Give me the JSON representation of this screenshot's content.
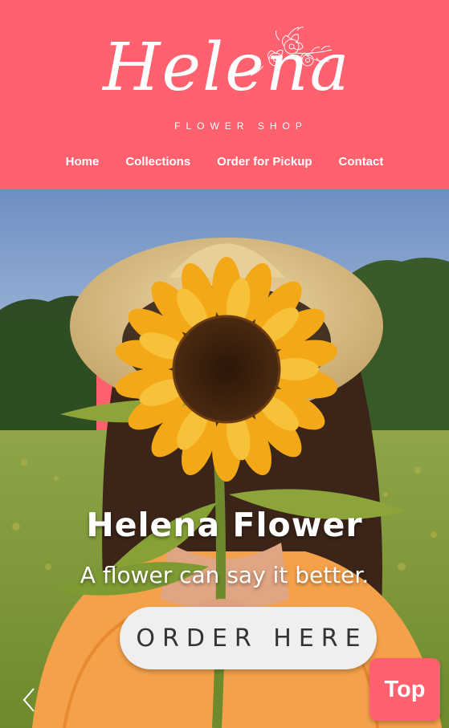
{
  "brand": {
    "title": "Helena",
    "subtitle": "FLOWER SHOP"
  },
  "nav": {
    "items": [
      {
        "label": "Home"
      },
      {
        "label": "Collections"
      },
      {
        "label": "Order for Pickup"
      },
      {
        "label": "Contact"
      }
    ]
  },
  "hero": {
    "title": "Helena Flower",
    "tagline": "A flower can say it better.",
    "cta_label": "ORDER HERE",
    "prev_icon": "chevron-left-icon",
    "next_icon": "chevron-right-icon"
  },
  "top_button": {
    "label": "Top"
  },
  "colors": {
    "brand": "#ff616f",
    "button_bg": "#efefef",
    "button_text": "#333333"
  }
}
